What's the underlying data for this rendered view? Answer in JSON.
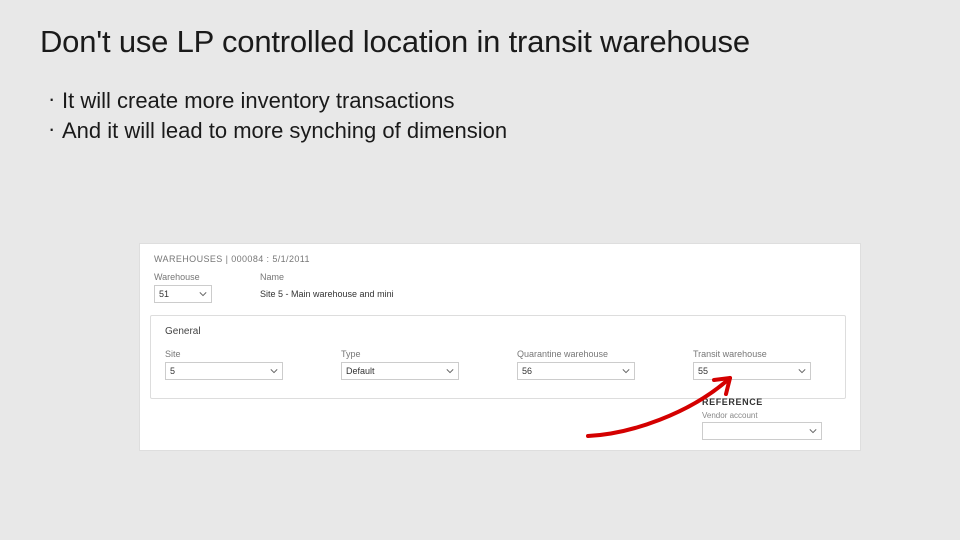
{
  "title": "Don't use LP controlled location in transit warehouse",
  "bullets": [
    "It will create more inventory transactions",
    "And it will lead to more synching of dimension"
  ],
  "screenshot": {
    "breadcrumb": "WAREHOUSES  |  000084 : 5/1/2011",
    "top": {
      "warehouse_label": "Warehouse",
      "warehouse_value": "51",
      "name_label": "Name",
      "name_value": "Site 5 - Main warehouse and mini"
    },
    "card": {
      "title": "General",
      "fields": {
        "site_label": "Site",
        "site_value": "5",
        "type_label": "Type",
        "type_value": "Default",
        "quarantine_label": "Quarantine warehouse",
        "quarantine_value": "56",
        "transit_label": "Transit warehouse",
        "transit_value": "55"
      }
    },
    "reference": {
      "heading": "REFERENCE",
      "label": "Vendor account"
    }
  }
}
